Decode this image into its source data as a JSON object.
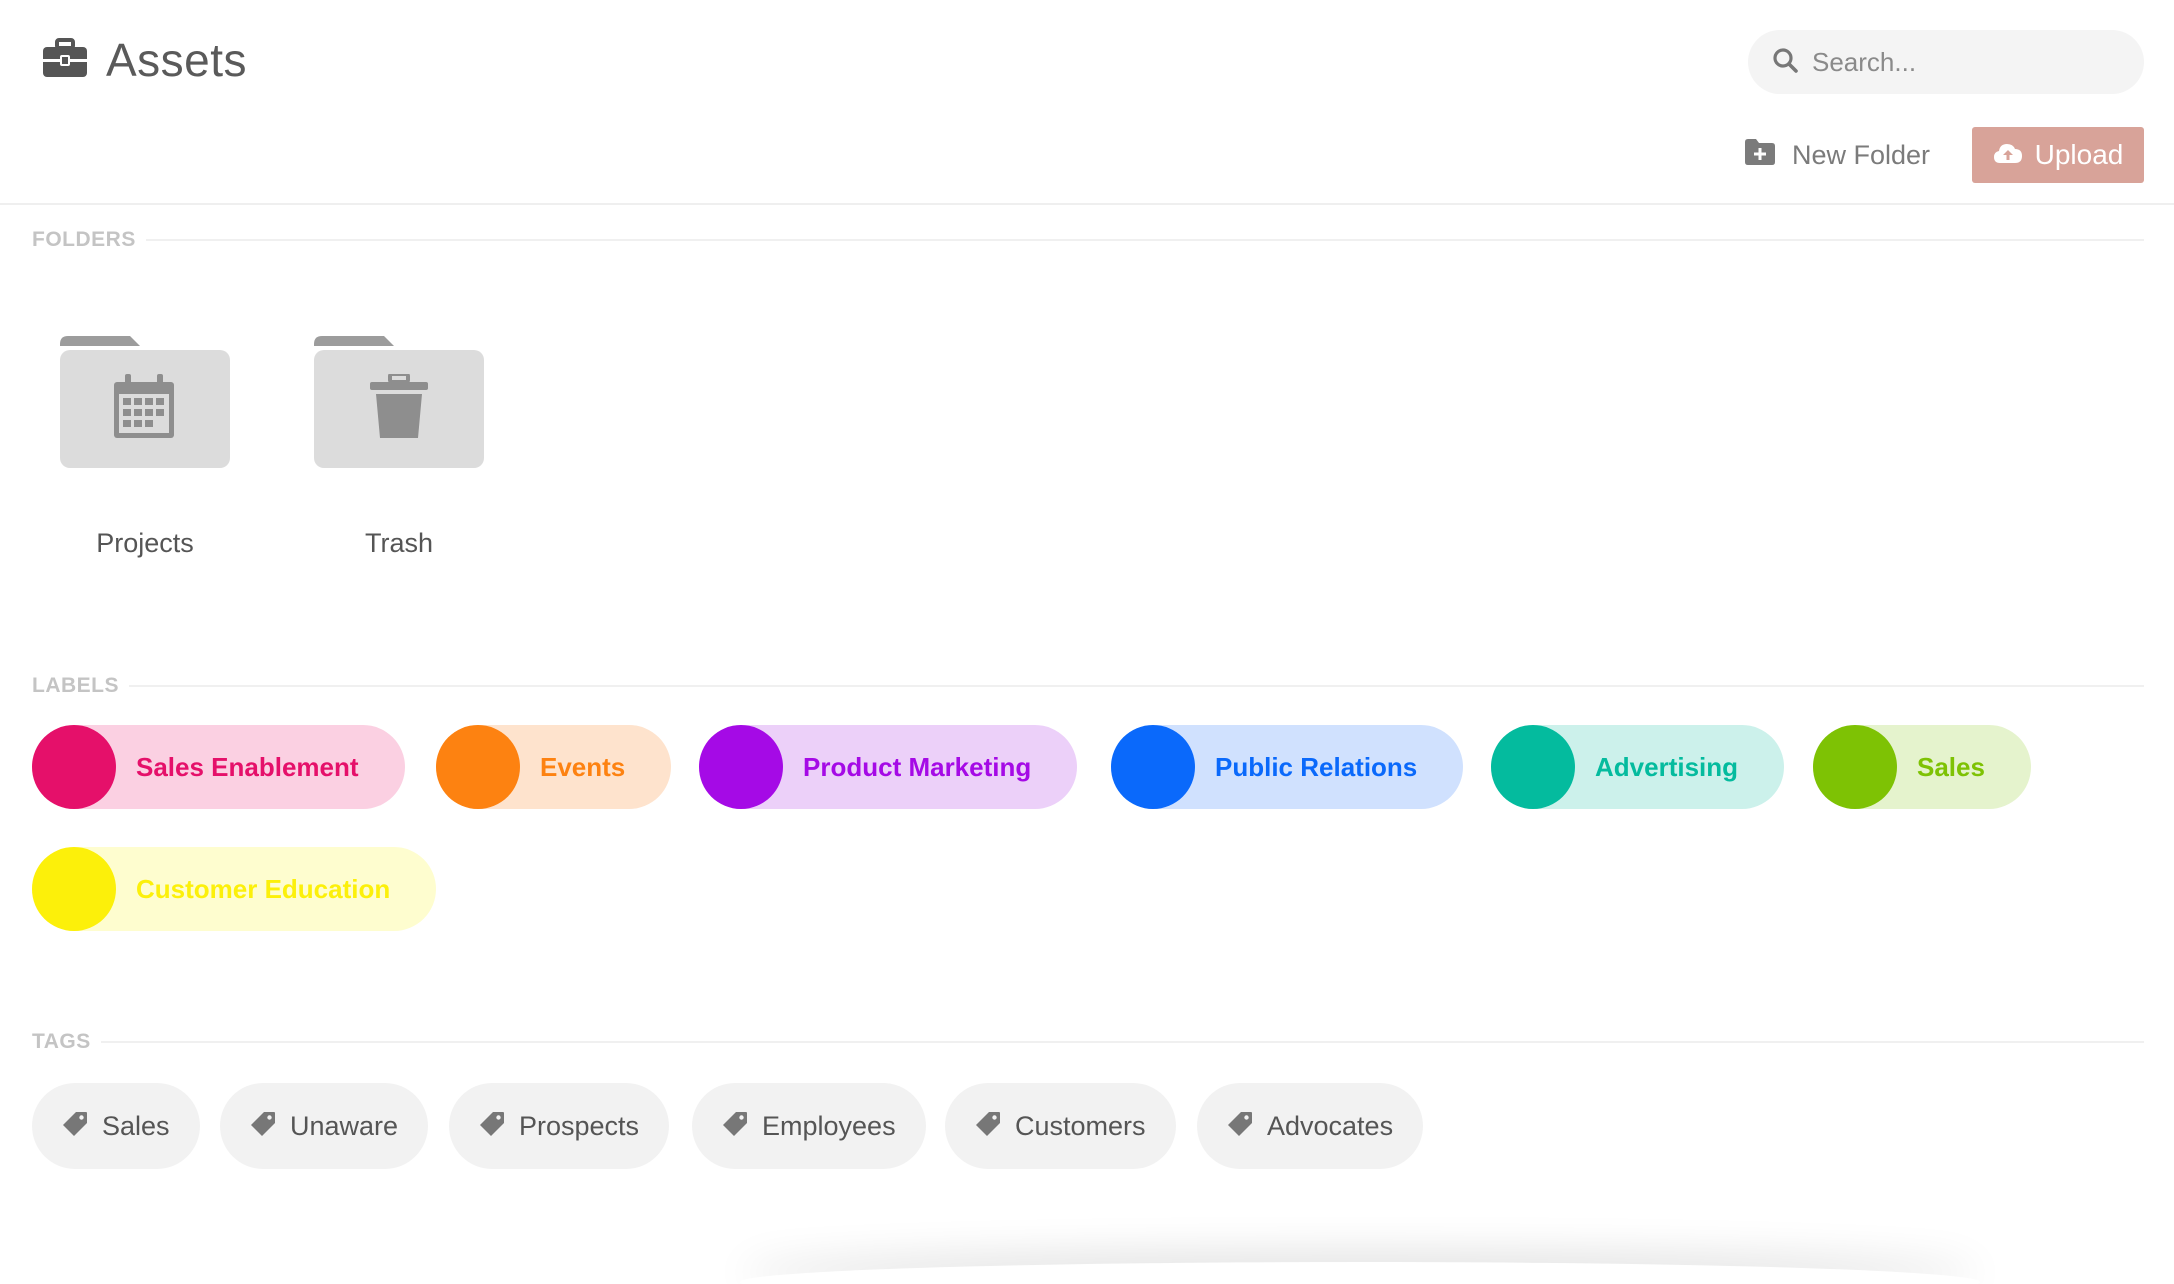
{
  "header": {
    "title": "Assets",
    "search_placeholder": "Search...",
    "new_folder_label": "New Folder",
    "upload_label": "Upload",
    "upload_color": "#d8a399"
  },
  "sections": {
    "folders": "FOLDERS",
    "labels": "LABELS",
    "tags": "TAGS"
  },
  "folders": [
    {
      "name": "Projects",
      "icon": "calendar-icon"
    },
    {
      "name": "Trash",
      "icon": "trash-icon"
    }
  ],
  "labels": [
    {
      "name": "Sales Enablement",
      "color": "#e5106a",
      "bg": "#fbd0e2"
    },
    {
      "name": "Events",
      "color": "#fd8211",
      "bg": "#fee3cd"
    },
    {
      "name": "Product Marketing",
      "color": "#a50ae6",
      "bg": "#ecd0f9"
    },
    {
      "name": "Public Relations",
      "color": "#0a69fb",
      "bg": "#d0e1fe"
    },
    {
      "name": "Advertising",
      "color": "#04bb9e",
      "bg": "#ccf1eb"
    },
    {
      "name": "Sales",
      "color": "#7ec204",
      "bg": "#e5f3cd"
    },
    {
      "name": "Customer Education",
      "color": "#fcf00a",
      "bg": "#fefdcf"
    }
  ],
  "tags": [
    {
      "name": "Sales"
    },
    {
      "name": "Unaware"
    },
    {
      "name": "Prospects"
    },
    {
      "name": "Employees"
    },
    {
      "name": "Customers"
    },
    {
      "name": "Advocates"
    }
  ]
}
